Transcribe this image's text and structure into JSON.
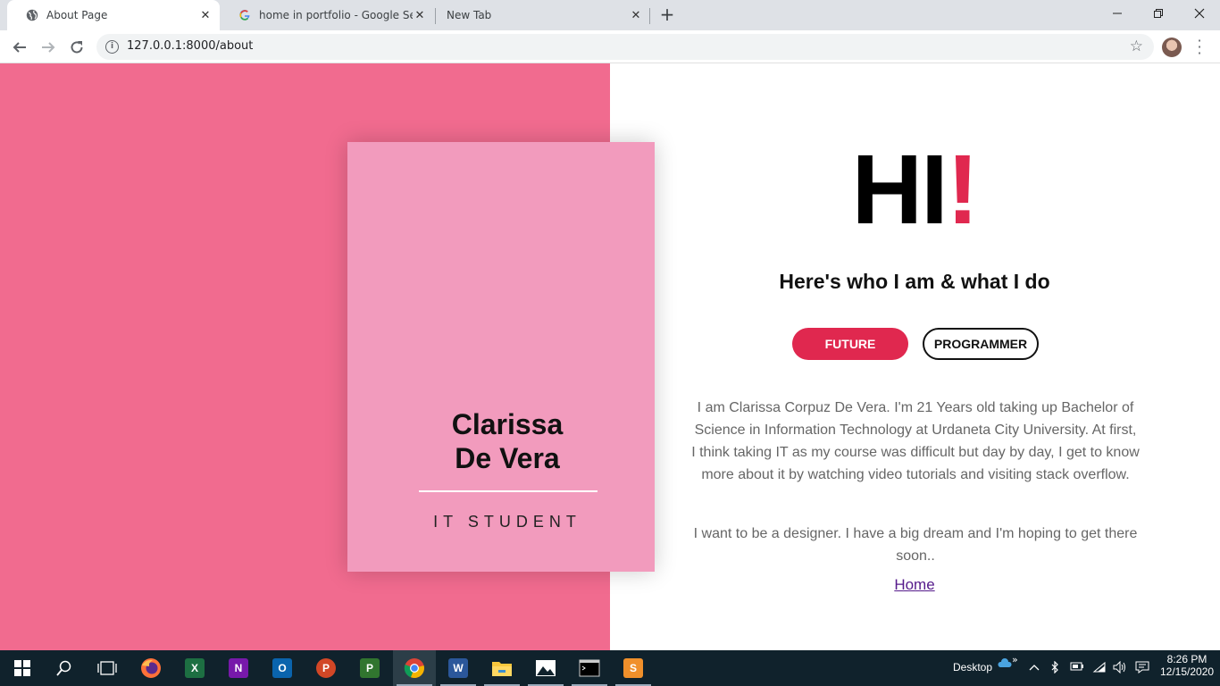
{
  "browser": {
    "tabs": [
      {
        "title": "About Page",
        "active": true
      },
      {
        "title": "home in portfolio - Google Searc",
        "active": false
      },
      {
        "title": "New Tab",
        "active": false
      }
    ],
    "new_tab_glyph": "+",
    "url": "127.0.0.1:8000/about"
  },
  "page": {
    "card": {
      "first_name": "Clarissa",
      "last_name": "De Vera",
      "role": "IT STUDENT"
    },
    "hi": {
      "text": "HI",
      "exclaim": "!"
    },
    "headline": "Here's who I am & what I do",
    "pills": {
      "future": "FUTURE",
      "programmer": "PROGRAMMER"
    },
    "paragraphs": [
      "I am Clarissa Corpuz De Vera. I'm 21 Years old taking up Bachelor of Science in Information Technology at Urdaneta City University. At first, I think taking IT as my course was difficult but day by day, I get to know more about it by watching video tutorials and visiting stack overflow.",
      "I want to be a designer. I have a big dream and I'm hoping to get there soon.."
    ],
    "home_link": "Home",
    "colors": {
      "pink_bg": "#f16b8f",
      "card": "#f29bbd",
      "accent": "#e0284f"
    }
  },
  "taskbar": {
    "desktop_label": "Desktop",
    "time": "8:26 PM",
    "date": "12/15/2020",
    "apps": [
      "windows-start",
      "search",
      "task-view",
      "firefox",
      "excel",
      "onenote",
      "outlook",
      "powerpoint",
      "project",
      "chrome",
      "word",
      "file-explorer",
      "photos",
      "terminal",
      "sublime-text"
    ]
  }
}
